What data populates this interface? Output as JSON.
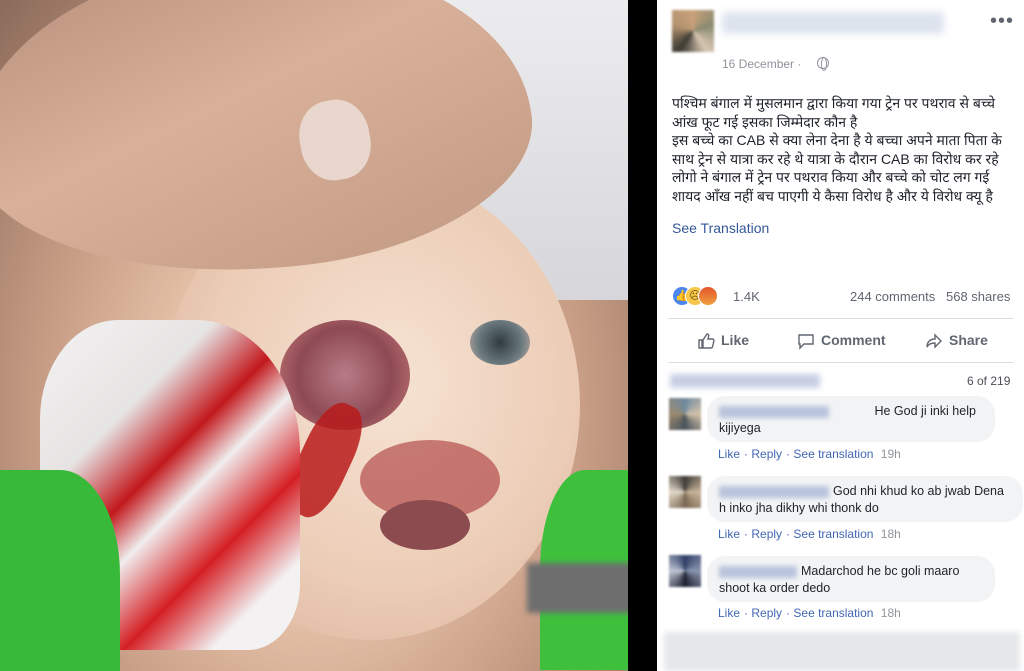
{
  "post": {
    "date": "16 December ·",
    "text": "पश्चिम बंगाल में मुसलमान द्वारा किया गया ट्रेन पर पथराव से बच्चे आंख फूट गई इसका जिम्मेदार कौन है\nइस बच्चे का CAB से क्या लेना देना है ये बच्चा अपने माता पिता के साथ ट्रेन से यात्रा कर रहे थे यात्रा के दौरान CAB का विरोध कर रहे लोगो ने बंगाल में ट्रेन पर पथराव किया और बच्चे को चोट लग गई शायद आँख नहीं बच पाएगी ये कैसा विरोध है और ये विरोध क्यू है",
    "see_translation": "See Translation"
  },
  "stats": {
    "reactions": "1.4K",
    "comments": "244 comments",
    "shares": "568 shares"
  },
  "actions": {
    "like": "Like",
    "comment": "Comment",
    "share": "Share"
  },
  "comments_header": {
    "pager": "6 of 219"
  },
  "comments": [
    {
      "name": "",
      "text": "He God ji inki help kijiyega",
      "like": "Like",
      "reply": "Reply",
      "see_translation": "See translation",
      "time": "19h"
    },
    {
      "name": "",
      "text": "God nhi khud ko ab jwab Dena h inko jha dikhy whi thonk do",
      "like": "Like",
      "reply": "Reply",
      "see_translation": "See translation",
      "time": "18h"
    },
    {
      "name": "",
      "text": "Madarchod he bc goli maaro shoot ka order dedo",
      "like": "Like",
      "reply": "Reply",
      "see_translation": "See translation",
      "time": "18h"
    }
  ],
  "icons": [
    "more-icon",
    "globe-icon",
    "like-icon",
    "comment-icon",
    "share-icon"
  ],
  "colors": {
    "link": "#365899",
    "accent": "#4267b2",
    "muted": "#90949c",
    "text": "#1d2129"
  }
}
